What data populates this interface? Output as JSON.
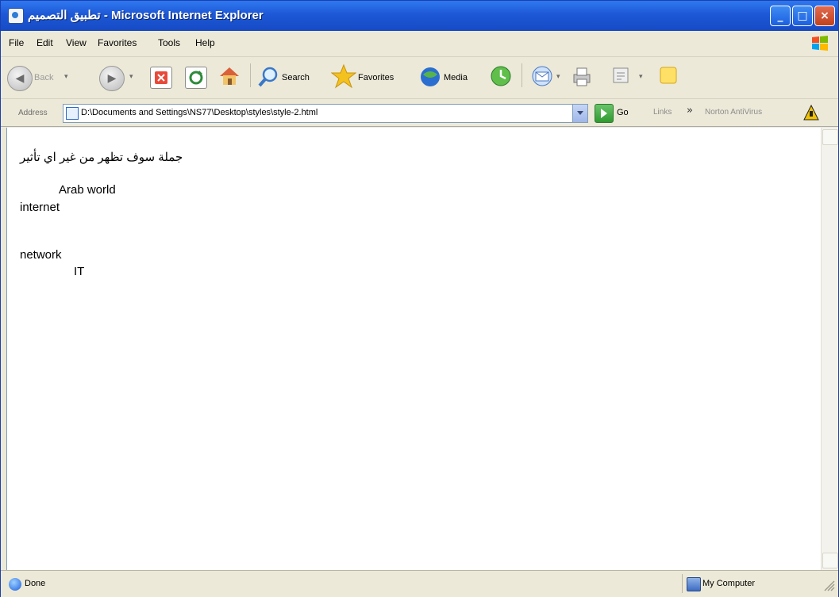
{
  "window": {
    "title_rtl": "تطبيق التصميم",
    "title_sep": " - ",
    "title_app": "Microsoft Internet Explorer",
    "min_glyph": "_",
    "max_glyph": "□",
    "close_glyph": "×"
  },
  "menu": {
    "items": [
      "File",
      "Edit",
      "View",
      "Favorites",
      "Tools",
      "Help"
    ]
  },
  "toolbar": {
    "back_label": "Back",
    "search_label": "Search",
    "favorites_label": "Favorites",
    "media_label": "Media",
    "dropdown_glyph": "▾",
    "icons": [
      "back-icon",
      "forward-icon",
      "stop-icon",
      "refresh-icon",
      "home-icon",
      "search-icon",
      "favorites-star-icon",
      "media-icon",
      "history-icon",
      "mail-icon",
      "print-icon",
      "edit-icon",
      "messenger-icon"
    ]
  },
  "address": {
    "label": "Address",
    "value": "D:\\Documents and Settings\\NS77\\Desktop\\styles\\style-2.html",
    "go_label": "Go",
    "links_label": "Links",
    "chevron": "»",
    "norton_label": "Norton AntiVirus"
  },
  "page": {
    "heading_ar": "جملة سوف تظهر من غير اي تأثير",
    "line1": "Arab world",
    "line2": "internet",
    "line3": "network",
    "line4": "IT"
  },
  "status": {
    "left_text": "Done",
    "zone_text": "My Computer"
  },
  "colors": {
    "titlebar": "#1d58d6",
    "chrome": "#ece9d8",
    "go_green": "#2f9a2f"
  }
}
